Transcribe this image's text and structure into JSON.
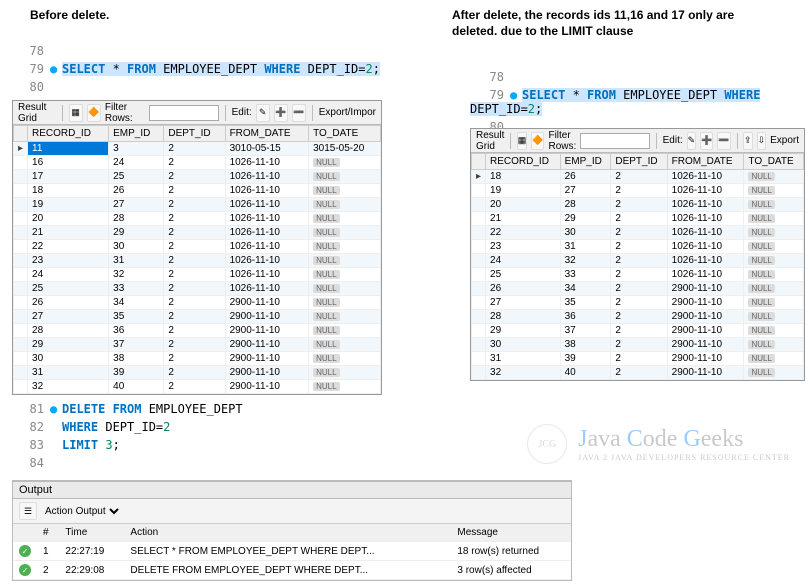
{
  "labels": {
    "before": "Before delete.",
    "after1": "After delete, the records ids 11,16 and 17 only are",
    "after2": "deleted. due to the LIMIT clause"
  },
  "code_left": {
    "ln78": "78",
    "ln79": "79",
    "ln80": "80",
    "sql": "SELECT * FROM EMPLOYEE_DEPT WHERE DEPT_ID=2;"
  },
  "code_right": {
    "ln78": "78",
    "ln79": "79",
    "ln80": "80",
    "sql": "SELECT * FROM EMPLOYEE_DEPT WHERE DEPT_ID=2;"
  },
  "code_mid": {
    "ln81": "81",
    "l81": "DELETE FROM EMPLOYEE_DEPT",
    "ln82": "82",
    "l82": "WHERE DEPT_ID=2",
    "ln83": "83",
    "l83": "LIMIT 3;",
    "ln84": "84"
  },
  "grid": {
    "titleLeft": "Result Grid",
    "filterLabel": "Filter Rows:",
    "editLabel": "Edit:",
    "exportLabel": "Export/Impor",
    "exportLabel2": "Export",
    "headers": [
      "RECORD_ID",
      "EMP_ID",
      "DEPT_ID",
      "FROM_DATE",
      "TO_DATE"
    ]
  },
  "left_rows": [
    [
      "11",
      "3",
      "2",
      "3010-05-15",
      "3015-05-20"
    ],
    [
      "16",
      "24",
      "2",
      "1026-11-10",
      "NULL"
    ],
    [
      "17",
      "25",
      "2",
      "1026-11-10",
      "NULL"
    ],
    [
      "18",
      "26",
      "2",
      "1026-11-10",
      "NULL"
    ],
    [
      "19",
      "27",
      "2",
      "1026-11-10",
      "NULL"
    ],
    [
      "20",
      "28",
      "2",
      "1026-11-10",
      "NULL"
    ],
    [
      "21",
      "29",
      "2",
      "1026-11-10",
      "NULL"
    ],
    [
      "22",
      "30",
      "2",
      "1026-11-10",
      "NULL"
    ],
    [
      "23",
      "31",
      "2",
      "1026-11-10",
      "NULL"
    ],
    [
      "24",
      "32",
      "2",
      "1026-11-10",
      "NULL"
    ],
    [
      "25",
      "33",
      "2",
      "1026-11-10",
      "NULL"
    ],
    [
      "26",
      "34",
      "2",
      "2900-11-10",
      "NULL"
    ],
    [
      "27",
      "35",
      "2",
      "2900-11-10",
      "NULL"
    ],
    [
      "28",
      "36",
      "2",
      "2900-11-10",
      "NULL"
    ],
    [
      "29",
      "37",
      "2",
      "2900-11-10",
      "NULL"
    ],
    [
      "30",
      "38",
      "2",
      "2900-11-10",
      "NULL"
    ],
    [
      "31",
      "39",
      "2",
      "2900-11-10",
      "NULL"
    ],
    [
      "32",
      "40",
      "2",
      "2900-11-10",
      "NULL"
    ]
  ],
  "right_rows": [
    [
      "18",
      "26",
      "2",
      "1026-11-10",
      "NULL"
    ],
    [
      "19",
      "27",
      "2",
      "1026-11-10",
      "NULL"
    ],
    [
      "20",
      "28",
      "2",
      "1026-11-10",
      "NULL"
    ],
    [
      "21",
      "29",
      "2",
      "1026-11-10",
      "NULL"
    ],
    [
      "22",
      "30",
      "2",
      "1026-11-10",
      "NULL"
    ],
    [
      "23",
      "31",
      "2",
      "1026-11-10",
      "NULL"
    ],
    [
      "24",
      "32",
      "2",
      "1026-11-10",
      "NULL"
    ],
    [
      "25",
      "33",
      "2",
      "1026-11-10",
      "NULL"
    ],
    [
      "26",
      "34",
      "2",
      "2900-11-10",
      "NULL"
    ],
    [
      "27",
      "35",
      "2",
      "2900-11-10",
      "NULL"
    ],
    [
      "28",
      "36",
      "2",
      "2900-11-10",
      "NULL"
    ],
    [
      "29",
      "37",
      "2",
      "2900-11-10",
      "NULL"
    ],
    [
      "30",
      "38",
      "2",
      "2900-11-10",
      "NULL"
    ],
    [
      "31",
      "39",
      "2",
      "2900-11-10",
      "NULL"
    ],
    [
      "32",
      "40",
      "2",
      "2900-11-10",
      "NULL"
    ]
  ],
  "output": {
    "title": "Output",
    "dropdown": "Action Output",
    "headers": [
      "",
      "#",
      "Time",
      "Action",
      "Message"
    ],
    "rows": [
      [
        "1",
        "22:27:19",
        "SELECT * FROM EMPLOYEE_DEPT WHERE DEPT...",
        "18 row(s) returned"
      ],
      [
        "2",
        "22:29:08",
        "DELETE FROM EMPLOYEE_DEPT  WHERE DEPT...",
        "3 row(s) affected"
      ]
    ]
  },
  "watermark": {
    "circle": "JCG",
    "text": "Java Code Geeks",
    "sub": "JAVA 2 JAVA DEVELOPERS RESOURCE CENTER"
  }
}
